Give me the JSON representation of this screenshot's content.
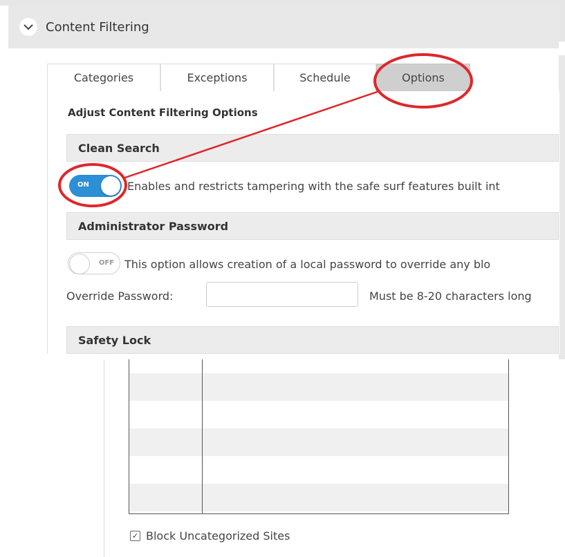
{
  "header": {
    "title": "Content Filtering",
    "toggle_icon": "chevron-down-icon"
  },
  "tabs": [
    {
      "label": "Categories",
      "active": false
    },
    {
      "label": "Exceptions",
      "active": false
    },
    {
      "label": "Schedule",
      "active": false
    },
    {
      "label": "Options",
      "active": true
    }
  ],
  "options": {
    "heading": "Adjust Content Filtering Options",
    "clean_search": {
      "title": "Clean Search",
      "toggle_label": "ON",
      "toggle_state": "on",
      "description": "Enables and restricts tampering with the safe surf features built int"
    },
    "admin_password": {
      "title": "Administrator Password",
      "toggle_label": "OFF",
      "toggle_state": "off",
      "description": "This option allows creation of a local password to override any blo",
      "field_label": "Override Password:",
      "field_value": "",
      "hint": "Must be 8-20 characters long"
    },
    "safety_lock": {
      "title": "Safety Lock"
    }
  },
  "categories_panel": {
    "block_uncategorized": {
      "label": "Block Uncategorized Sites",
      "checked": true
    }
  },
  "colors": {
    "toggle_on": "#2d8fd5",
    "annotation": "#e0262b",
    "header_bg": "#e8e8e8"
  }
}
